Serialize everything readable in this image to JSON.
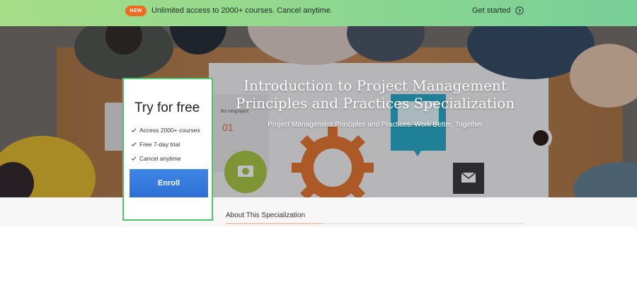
{
  "promo": {
    "badge": "NEW",
    "text": "Unlimited access to 2000+ courses. Cancel anytime.",
    "cta": "Get started"
  },
  "hero": {
    "title": "Introduction to Project Management Principles and Practices Specialization",
    "subtitle": "Project Management Principles and Practices. Work Better, Together",
    "image_labels": {
      "infographic_title": "Biz Infographic",
      "infographic_number": "01"
    }
  },
  "card": {
    "title": "Try for free",
    "features": [
      "Access 2000+ courses",
      "Free 7-day trial",
      "Cancel anytime"
    ],
    "button": "Enroll"
  },
  "tabs": {
    "about": "About This Specialization"
  },
  "colors": {
    "promo_start": "#a6dd88",
    "promo_end": "#78cf98",
    "badge": "#f26a1f",
    "card_border": "#4ec46b",
    "enroll": "#2c6fd3"
  },
  "icons": {
    "promo_cta": "arrow-right-circle-icon",
    "feature": "check-icon"
  }
}
